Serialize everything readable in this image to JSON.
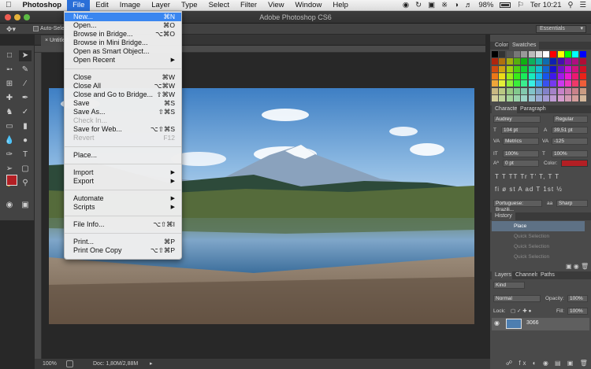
{
  "menubar": {
    "apple": "",
    "app": "Photoshop",
    "items": [
      "File",
      "Edit",
      "Image",
      "Layer",
      "Type",
      "Select",
      "Filter",
      "View",
      "Window",
      "Help"
    ],
    "battery": "98%",
    "clock": "Ter 10:21"
  },
  "window": {
    "title": "Adobe Photoshop CS6"
  },
  "options": {
    "auto_select": "Auto-Select",
    "workspace": "Essentials"
  },
  "document": {
    "tab": "Untitled",
    "zoom": "100%",
    "doc_info": "Doc: 1,80M/2,88M"
  },
  "file_menu": {
    "groups": [
      [
        {
          "label": "New...",
          "shortcut": "⌘N",
          "highlight": true
        },
        {
          "label": "Open...",
          "shortcut": "⌘O"
        },
        {
          "label": "Browse in Bridge...",
          "shortcut": "⌥⌘O"
        },
        {
          "label": "Browse in Mini Bridge...",
          "shortcut": ""
        },
        {
          "label": "Open as Smart Object...",
          "shortcut": ""
        },
        {
          "label": "Open Recent",
          "shortcut": "",
          "submenu": true
        }
      ],
      [
        {
          "label": "Close",
          "shortcut": "⌘W"
        },
        {
          "label": "Close All",
          "shortcut": "⌥⌘W"
        },
        {
          "label": "Close and Go to Bridge...",
          "shortcut": "⇧⌘W"
        },
        {
          "label": "Save",
          "shortcut": "⌘S"
        },
        {
          "label": "Save As...",
          "shortcut": "⇧⌘S"
        },
        {
          "label": "Check In...",
          "shortcut": "",
          "disabled": true
        },
        {
          "label": "Save for Web...",
          "shortcut": "⌥⇧⌘S"
        },
        {
          "label": "Revert",
          "shortcut": "F12",
          "disabled": true
        }
      ],
      [
        {
          "label": "Place...",
          "shortcut": ""
        }
      ],
      [
        {
          "label": "Import",
          "shortcut": "",
          "submenu": true
        },
        {
          "label": "Export",
          "shortcut": "",
          "submenu": true
        }
      ],
      [
        {
          "label": "Automate",
          "shortcut": "",
          "submenu": true
        },
        {
          "label": "Scripts",
          "shortcut": "",
          "submenu": true
        }
      ],
      [
        {
          "label": "File Info...",
          "shortcut": "⌥⇧⌘I"
        }
      ],
      [
        {
          "label": "Print...",
          "shortcut": "⌘P"
        },
        {
          "label": "Print One Copy",
          "shortcut": "⌥⇧⌘P"
        }
      ]
    ]
  },
  "swatches": {
    "tabs": [
      "Color",
      "Swatches"
    ]
  },
  "character": {
    "tabs": [
      "Character",
      "Paragraph"
    ],
    "font": "Audrey",
    "style": "Regular",
    "size": "104 pt",
    "leading": "39,51 pt",
    "kerning": "Metrics",
    "tracking": "-125",
    "vscale": "100%",
    "hscale": "100%",
    "baseline": "0 pt",
    "color_label": "Color:",
    "language": "Portuguese: Brazili...",
    "aa": "Sharp",
    "glyph_row1": "T T TT Tr T' T, T T",
    "glyph_row2": "fi ø st A ad T 1st ½"
  },
  "history": {
    "tab": "History",
    "items": [
      {
        "label": "Place",
        "active": true
      },
      {
        "label": "Quick Selection"
      },
      {
        "label": "Quick Selection"
      },
      {
        "label": "Quick Selection"
      }
    ]
  },
  "layers": {
    "tabs": [
      "Layers",
      "Channels",
      "Paths"
    ],
    "filter": "Kind",
    "blend": "Normal",
    "opacity_label": "Opacity:",
    "opacity": "100%",
    "lock_label": "Lock:",
    "fill_label": "Fill:",
    "fill": "100%",
    "layer_name": "3066"
  },
  "colors": {
    "accent": "#2a6fd8",
    "foreground": "#b31f24",
    "panel": "#4a4a4a"
  }
}
